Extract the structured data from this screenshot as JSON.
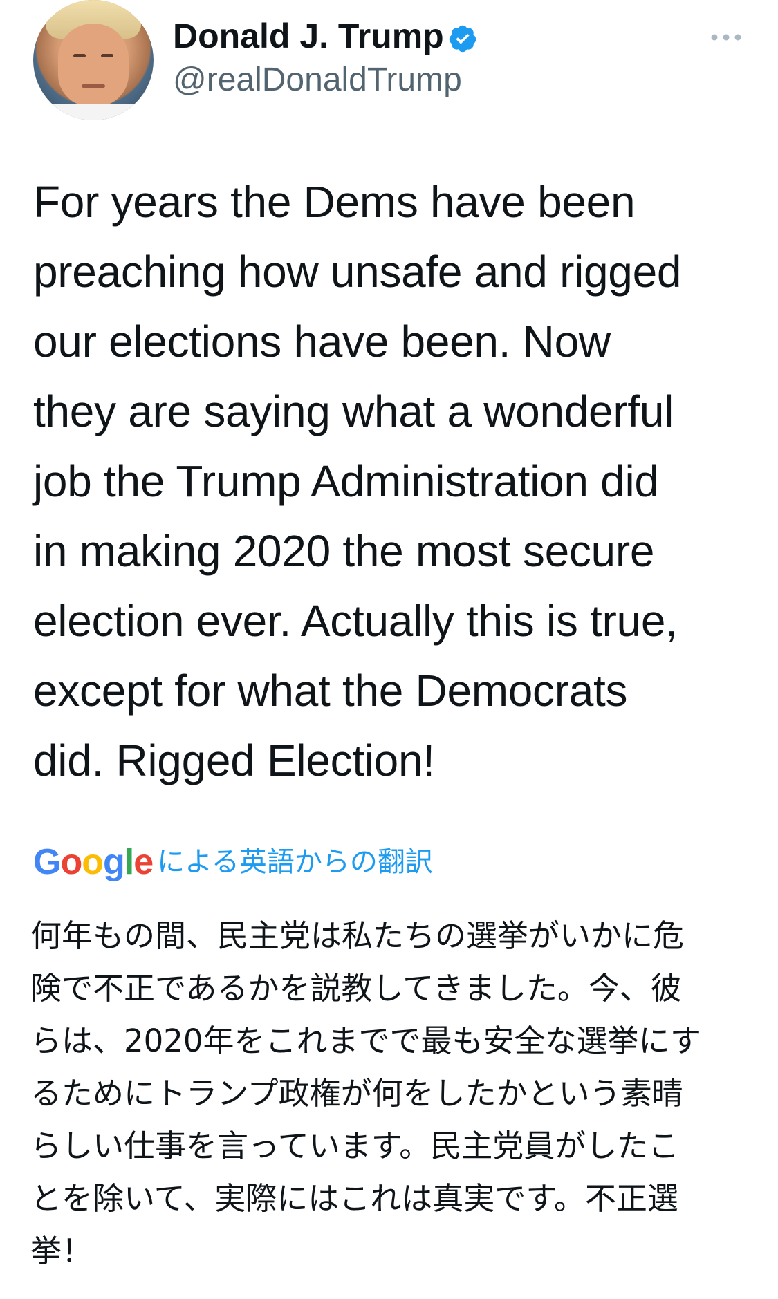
{
  "author": {
    "display_name": "Donald J. Trump",
    "handle": "@realDonaldTrump",
    "verified": true,
    "avatar_icon": "profile-photo-avatar"
  },
  "menu": {
    "icon": "more-options-icon"
  },
  "tweet": {
    "text": "For years the Dems have been\npreaching how unsafe and rigged\nour elections have been. Now\nthey are saying what a wonderful\njob the Trump Administration did\nin making 2020 the most secure\nelection ever. Actually this is true,\nexcept for what the Democrats\ndid. Rigged Election!"
  },
  "translation": {
    "provider_logo": [
      "G",
      "o",
      "o",
      "g",
      "l",
      "e"
    ],
    "provider_logo_colors": [
      "#4285f4",
      "#ea4335",
      "#fbbc05",
      "#4285f4",
      "#34a853",
      "#ea4335"
    ],
    "label": "による英語からの翻訳",
    "text": "何年もの間、民主党は私たちの選挙がいかに危\n険で不正であるかを説教してきました。今、彼\nらは、2020年をこれまでで最も安全な選挙にす\nるためにトランプ政権が何をしたかという素晴\nらしい仕事を言っています。民主党員がしたこ\nとを除いて、実際にはこれは真実です。不正選\n挙！"
  },
  "colors": {
    "verified_blue": "#1d9bf0",
    "link_blue": "#1d9bf0",
    "secondary_text": "#536471",
    "text": "#0f1419"
  }
}
